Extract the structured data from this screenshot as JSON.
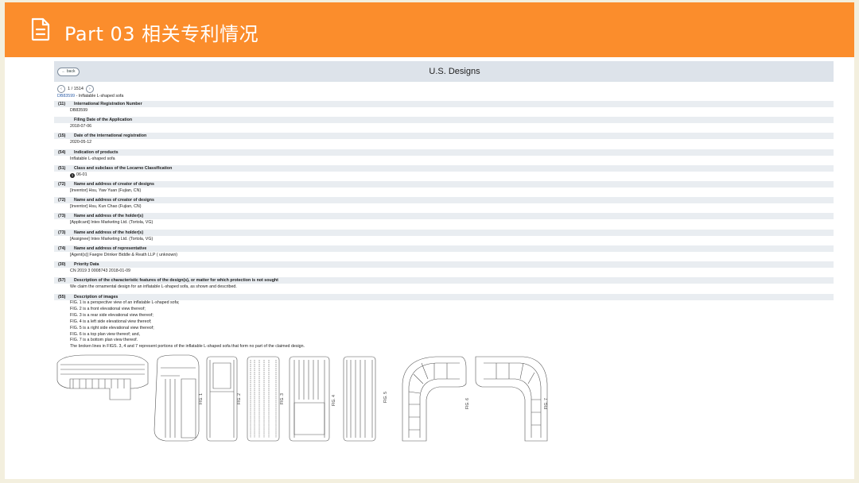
{
  "header": {
    "title": "Part 03  相关专利情况",
    "icon": "document-icon",
    "color": "#fb8d2c"
  },
  "topbar": {
    "back_label": "← back",
    "heading": "U.S. Designs"
  },
  "pager": {
    "prev_icon": "chevron-left-icon",
    "text": "1 / 1514",
    "next_icon": "chevron-right-icon"
  },
  "record": {
    "id": "DB83599",
    "title_suffix": " - Inflatable L-shaped sofa"
  },
  "fields": [
    {
      "num": "(11)",
      "label": "International Registration Number",
      "value": "DB83599"
    },
    {
      "num": "",
      "label": "Filing Date of the Application",
      "value": "2018-07-06"
    },
    {
      "num": "(15)",
      "label": "Date of the international registration",
      "value": "2020-05-12"
    },
    {
      "num": "(54)",
      "label": "Indication of products",
      "value": "Inflatable L-shaped sofa"
    },
    {
      "num": "(51)",
      "label": "Class and subclass of the Locarno Classification",
      "value": "06-01",
      "bullet": "1"
    },
    {
      "num": "(72)",
      "label": "Name and address of creator of designs",
      "value": "[Inventor] Hsu, Yaw Yuan (Fujian, CN)"
    },
    {
      "num": "(72)",
      "label": "Name and address of creator of designs",
      "value": "[Inventor] Hsu, Kun Chao (Fujian, CN)"
    },
    {
      "num": "(73)",
      "label": "Name and address of the holder(s)",
      "value": "[Applicant]  Intex Marketing Ltd. (Tortola, VG)"
    },
    {
      "num": "(73)",
      "label": "Name and address of the holder(s)",
      "value": "[Assignee]  Intex Marketing Ltd. (Tortola, VG)"
    },
    {
      "num": "(74)",
      "label": "Name and address of representative",
      "value": "[Agent(s)] Faegre Drinker Biddle & Reath LLP ( unknown)"
    },
    {
      "num": "(30)",
      "label": "Priority Data",
      "value": "CN 2019 3 0008743 2018-01-09"
    },
    {
      "num": "(57)",
      "label": "Description of the characteristic features of the design(s), or matter for which protection is not sought",
      "value": "We claim the ornamental design for an inflatable L-shaped sofa, as shown and described."
    }
  ],
  "images_block": {
    "num": "(55)",
    "label": "Description of images",
    "lines": [
      "FIG. 1 is a perspective view of an inflatable L-shaped sofa;",
      "FIG. 2 is a front elevational view thereof;",
      "FIG. 3 is a rear side elevational view thereof;",
      "FIG. 4 is a left side elevational view thereof;",
      "FIG. 5 is a right side elevational view thereof;",
      "FIG. 6 is a top plan view thereof; and,",
      "FIG. 7 is a bottom plan view thereof.",
      "The broken lines in FIGS. 3, 4 and 7 represent portions of the inflatable L-shaped sofa that form no part of the claimed design."
    ]
  },
  "figure_labels": [
    "FIG. 1",
    "FIG. 2",
    "FIG. 3",
    "FIG. 4",
    "FIG. 5",
    "FIG. 6",
    "FIG. 7"
  ]
}
